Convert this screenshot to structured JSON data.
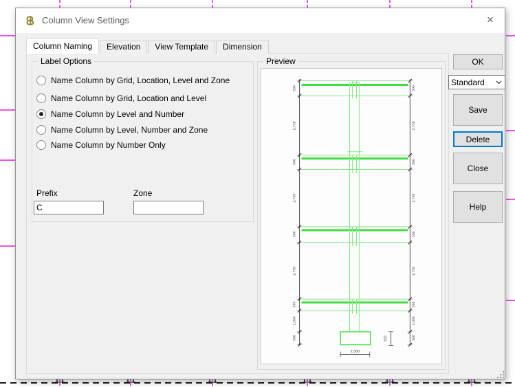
{
  "window": {
    "title": "Column View Settings",
    "close_glyph": "×"
  },
  "tabs": [
    {
      "label": "Column Naming",
      "active": true
    },
    {
      "label": "Elevation",
      "active": false
    },
    {
      "label": "View Template",
      "active": false
    },
    {
      "label": "Dimension",
      "active": false
    }
  ],
  "label_options": {
    "group_title": "Label Options",
    "radios": [
      {
        "label": "Name Column by Grid, Location, Level and Zone",
        "selected": false
      },
      {
        "label": "Name Column by Grid, Location and Level",
        "selected": false
      },
      {
        "label": "Name Column by Level and Number",
        "selected": true
      },
      {
        "label": "Name Column by Level, Number and Zone",
        "selected": false
      },
      {
        "label": "Name Column by Number Only",
        "selected": false
      }
    ],
    "prefix_label": "Prefix",
    "prefix_value": "C",
    "zone_label": "Zone",
    "zone_value": ""
  },
  "preview": {
    "group_title": "Preview",
    "dim_labels": [
      "500",
      "2,750",
      "500",
      "2,750",
      "500",
      "2,750",
      "500",
      "1,000",
      "500"
    ],
    "footing_width_label": "1,500",
    "footing_height_label": "500"
  },
  "buttons": {
    "ok": "OK",
    "save": "Save",
    "delete": "Delete",
    "close": "Close",
    "help": "Help"
  },
  "template_selector": {
    "value": "Standard"
  },
  "colors": {
    "magenta_grid": "#ec19ec",
    "green_light": "#86e886",
    "green_bright": "#3fdf3f",
    "dim_line": "#4d4d4d",
    "focus_accent": "#0078d7",
    "app_icon_gold": "#958330"
  }
}
